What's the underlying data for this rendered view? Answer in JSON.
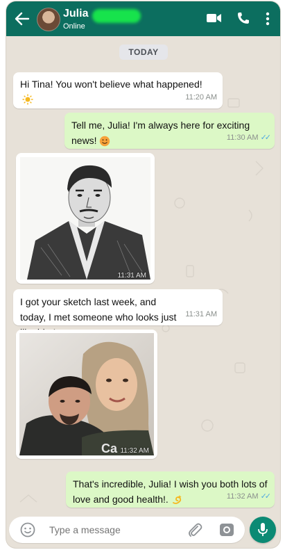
{
  "header": {
    "contact_name": "Julia",
    "status": "Online",
    "icons": [
      "back-arrow-icon",
      "video-call-icon",
      "phone-icon",
      "more-vert-icon"
    ]
  },
  "date_chip": "TODAY",
  "messages": [
    {
      "id": "m1",
      "direction": "in",
      "text": "Hi Tina! You won't believe what happened!",
      "emoji": "sun-emoji",
      "time": "11:20 AM"
    },
    {
      "id": "m2",
      "direction": "out",
      "text": "Tell me, Julia! I'm always here for exciting news!",
      "emoji": "smile-emoji",
      "time": "11:30 AM",
      "read": true
    },
    {
      "id": "m3",
      "direction": "in",
      "type": "image",
      "description": "pencil-sketch-portrait",
      "time": "11:31 AM"
    },
    {
      "id": "m4",
      "direction": "in",
      "text": "I got your sketch last week, and today, I met someone who looks just like him!",
      "time": "11:31 AM"
    },
    {
      "id": "m5",
      "direction": "in",
      "type": "image",
      "description": "selfie-photo",
      "time": "11:32 AM"
    },
    {
      "id": "m6",
      "direction": "out",
      "text": "That's incredible, Julia! I wish you both lots of love and good health!.",
      "emoji": "dizzy-emoji",
      "time": "11:32 AM",
      "read": true
    }
  ],
  "composer": {
    "placeholder": "Type a message",
    "icons": [
      "emoji-icon",
      "attach-icon",
      "camera-icon",
      "mic-icon"
    ]
  },
  "colors": {
    "header": "#0c6e5f",
    "outgoing_bubble": "#dcf8c6",
    "incoming_bubble": "#ffffff",
    "wallpaper": "#e7e1d8",
    "read_ticks": "#4fa8e0",
    "mic_button": "#0c8a74"
  }
}
